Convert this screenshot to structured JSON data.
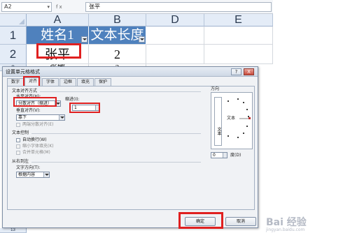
{
  "spreadsheet": {
    "name_box": "A2",
    "formula_value": "张平",
    "fx_label": "fx",
    "columns": [
      "A",
      "B",
      "D",
      "E"
    ],
    "rows": [
      "1",
      "2",
      "3"
    ],
    "header_cells": [
      "姓名1",
      "文本长度"
    ],
    "data_row": {
      "name": "张平",
      "length": "2"
    },
    "partial_row": {
      "name": "张娜",
      "length": "2"
    }
  },
  "dialog": {
    "title": "设置单元格格式",
    "help_label": "?",
    "close_label": "X",
    "tabs": [
      "数字",
      "对齐",
      "字体",
      "边框",
      "填充",
      "保护"
    ],
    "text_alignment": {
      "section": "文本对齐方式",
      "horizontal_label": "水平对齐(H):",
      "horizontal_value": "分散对齐（缩进）",
      "indent_label": "缩进(I):",
      "indent_value": "1",
      "vertical_label": "垂直对齐(V):",
      "vertical_value": "靠下",
      "justify_distributed": "两端分散对齐(E)"
    },
    "text_control": {
      "section": "文本控制",
      "wrap": "自动换行(W)",
      "shrink": "缩小字体填充(K)",
      "merge": "合并单元格(M)"
    },
    "rtl": {
      "section": "从右到左",
      "direction_label": "文字方向(T):",
      "direction_value": "根据内容"
    },
    "orientation": {
      "section": "方向",
      "vertical_text": "文本",
      "horizontal_text": "文本",
      "degrees_value": "0",
      "degrees_label": "度(D)"
    },
    "ok": "确定",
    "cancel": "取消"
  },
  "watermark": {
    "main": "Bai 经验",
    "sub": "jingyan.baidu.com"
  },
  "colors": {
    "header_fill": "#4f81bd",
    "highlight": "#e02020"
  }
}
